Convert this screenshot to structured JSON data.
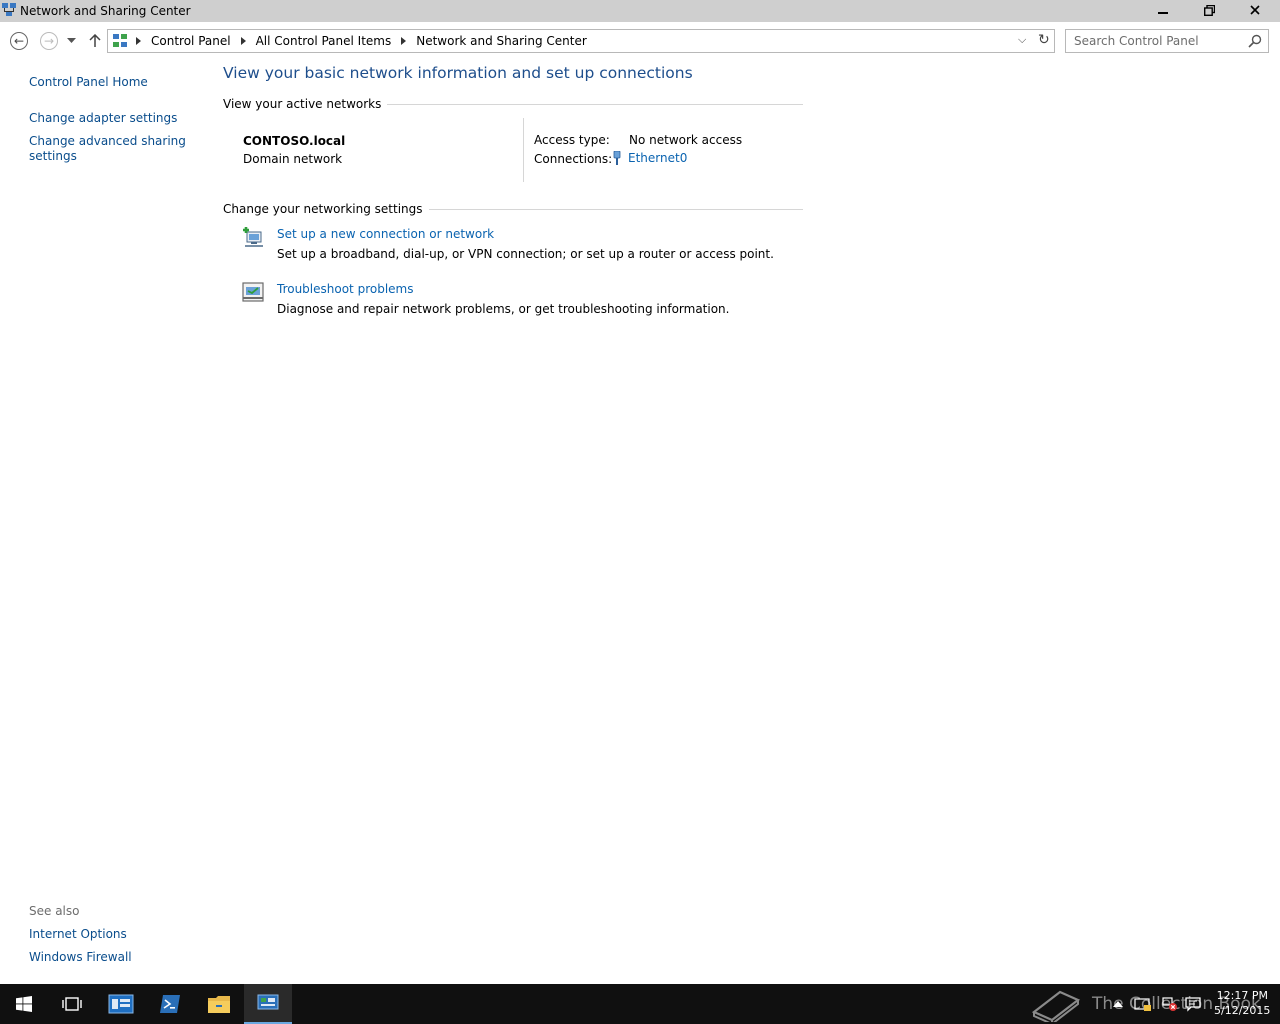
{
  "window": {
    "title": "Network and Sharing Center",
    "controls": {
      "minimize": "minimize-icon",
      "maximize": "restore-icon",
      "close": "close-icon"
    }
  },
  "address": {
    "icon": "control-panel-icon",
    "crumbs": [
      "Control Panel",
      "All Control Panel Items",
      "Network and Sharing Center"
    ],
    "search_placeholder": "Search Control Panel"
  },
  "left": {
    "home": "Control Panel Home",
    "adapter": "Change adapter settings",
    "advanced": "Change advanced sharing settings",
    "see_also_heading": "See also",
    "internet_options": "Internet Options",
    "firewall": "Windows Firewall"
  },
  "main": {
    "title": "View your basic network information and set up connections",
    "active_heading": "View your active networks",
    "network": {
      "name": "CONTOSO.local",
      "type": "Domain network",
      "access_label": "Access type:",
      "access_value": "No network access",
      "connections_label": "Connections:",
      "connection": "Ethernet0"
    },
    "change_heading": "Change your networking settings",
    "tasks": [
      {
        "icon": "new-connection-icon",
        "link": "Set up a new connection or network",
        "desc": "Set up a broadband, dial-up, or VPN connection; or set up a router or access point."
      },
      {
        "icon": "troubleshoot-icon",
        "link": "Troubleshoot problems",
        "desc": "Diagnose and repair network problems, or get troubleshooting information."
      }
    ]
  },
  "taskbar": {
    "items": [
      "start-icon",
      "task-view-icon",
      "server-manager-icon",
      "powershell-icon",
      "file-explorer-icon",
      "control-panel-icon"
    ],
    "watermark": "The Collection Book",
    "time": "12:17 PM",
    "date": "5/12/2015"
  },
  "colors": {
    "link": "#0a63b0",
    "title": "#1e4e8c",
    "titlebar": "#cfcfcf",
    "taskbar": "#101010"
  }
}
